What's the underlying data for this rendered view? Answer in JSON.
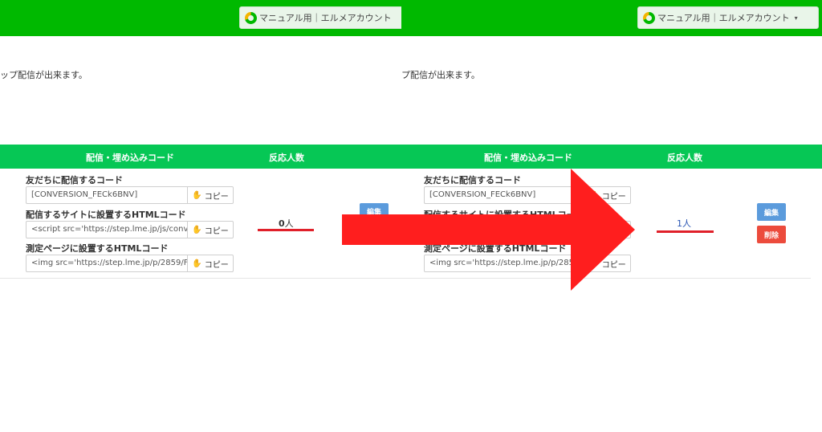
{
  "header": {
    "account_label": "マニュアル用｜エルメアカウント",
    "caret": "▾"
  },
  "left": {
    "intro": "ップ配信が出来ます。",
    "table": {
      "col_code": "配信・埋め込みコード",
      "col_count": "反応人数"
    },
    "fields": [
      {
        "label": "友だちに配信するコード",
        "value": "[CONVERSION_FECk6BNV]"
      },
      {
        "label": "配信するサイトに設置するHTMLコード",
        "value": "<script src='https://step.lme.jp/js/conve"
      },
      {
        "label": "測定ページに設置するHTMLコード",
        "value": "<img src='https://step.lme.jp/p/2859/F"
      }
    ],
    "copy_label": "コピー",
    "count_number": "0",
    "count_unit": "人",
    "edit_label": "編集"
  },
  "right": {
    "intro": "プ配信が出来ます。",
    "table": {
      "col_code": "配信・埋め込みコード",
      "col_count": "反応人数"
    },
    "fields": [
      {
        "label": "友だちに配信するコード",
        "value": "[CONVERSION_FECk6BNV]"
      },
      {
        "label": "配信するサイトに設置するHTMLコード",
        "value": ""
      },
      {
        "label": "測定ページに設置するHTMLコード",
        "value": "<img src='https://step.lme.jp/p/2859"
      }
    ],
    "copy_label": "コピー",
    "count_text": "1人",
    "edit_label": "編集",
    "delete_label": "削除"
  },
  "colors": {
    "top_bar": "#00b900",
    "table_header": "#06c755",
    "edit_button": "#5b9bdc",
    "delete_button": "#ec4b3c",
    "arrow": "#ff1e1e",
    "underline": "#e0202a"
  },
  "icons": {
    "copy": "hand-icon",
    "logo": "lme-logo-icon"
  }
}
